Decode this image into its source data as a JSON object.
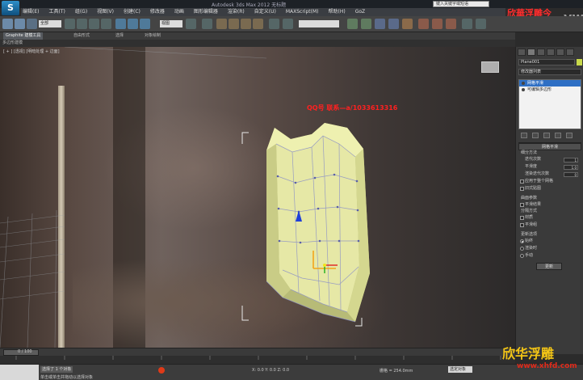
{
  "window": {
    "logo": "S",
    "title": "Autodesk 3ds Max 2012     无标题",
    "search_placeholder": "键入关键字或短语",
    "brand_mark": "欣華浮雕今",
    "corner_mark": "yw"
  },
  "menu": [
    "编辑(E)",
    "工具(T)",
    "组(G)",
    "视图(V)",
    "创建(C)",
    "修改器",
    "动画",
    "图形编辑器",
    "渲染(R)",
    "自定义(U)",
    "MAXScript(M)",
    "帮助(H)",
    "GoZ"
  ],
  "toolbar": {
    "selection_filter": "全部",
    "reference_coord": "视图"
  },
  "ribbon": {
    "tabs": [
      "Graphite 建模工具",
      "自由形式",
      "选择",
      "对象绘制"
    ],
    "sublabel": "多边形建模"
  },
  "viewport": {
    "label": "[ + ] [透视] [明暗处理 + 边面]",
    "overlay_text": "QQ号  联系—a/1033613316"
  },
  "command_panel": {
    "object_name": "Plane001",
    "object_color": "#c8d94a",
    "modifier_list": "修改器列表",
    "stack": [
      {
        "label": "网格平滑",
        "selected": true
      },
      {
        "label": "可编辑多边形",
        "selected": false
      }
    ],
    "rollout_title": "网格平滑",
    "subdivision_method": "细分方法",
    "iterations_label": "迭代次数",
    "iterations_value": "1",
    "smoothness_label": "平滑度",
    "smoothness_value": "1.0",
    "render_iters_label": "渲染迭代次数",
    "render_iters_value": "0",
    "options": [
      "应用于整个网格",
      "旧式贴图"
    ],
    "surface_params": "曲面参数",
    "smooth_result": "平滑结果",
    "separate_by": "分隔方式",
    "separate_opts": [
      "材质",
      "平滑组"
    ],
    "update_options": "更新选项",
    "update_modes": [
      {
        "label": "始终",
        "on": true
      },
      {
        "label": "渲染时",
        "on": false
      },
      {
        "label": "手动",
        "on": false
      }
    ],
    "update_button": "更新"
  },
  "timeline": {
    "label": "0 / 100"
  },
  "status": {
    "selected": "选择了 1 个对象",
    "prompt": "单击或单击并拖动以选择对象",
    "coords": "X: 0.0   Y: 0.0   Z: 0.0",
    "grid": "栅格 = 254.0mm",
    "key_filter": "选定对象"
  },
  "watermark": {
    "cn": "欣华浮雕",
    "url": "www.xhfd.com"
  },
  "colors": {
    "mesh_fill": "#e6e8a6",
    "mesh_edge": "#8a8fc8",
    "overlay_red": "#ff2020",
    "watermark_gold": "#f2c416"
  }
}
